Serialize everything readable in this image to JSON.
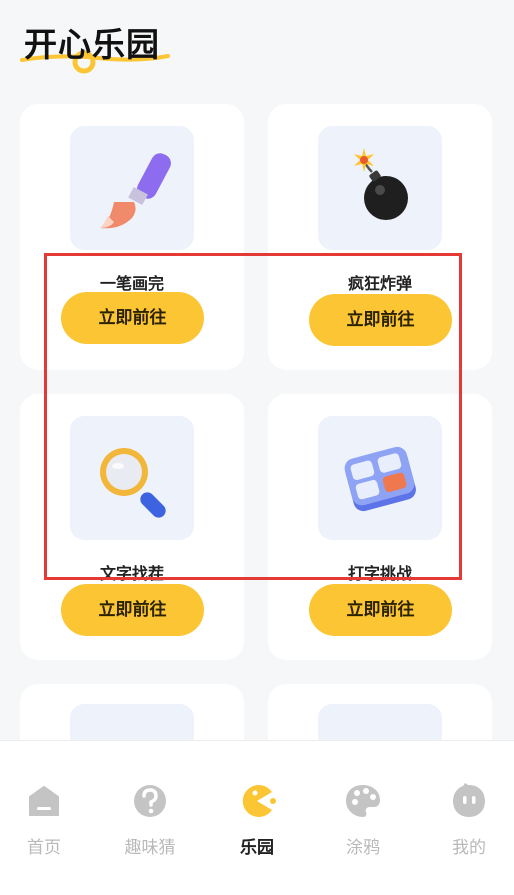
{
  "header": {
    "title": "开心乐园"
  },
  "colors": {
    "accent": "#fcc534",
    "highlight_border": "#e53935",
    "tab_inactive": "#c4c4c4",
    "tab_active": "#fcc534"
  },
  "cards": [
    {
      "label": "一笔画完",
      "button": "立即前往",
      "icon": "paintbrush-icon"
    },
    {
      "label": "疯狂炸弹",
      "button": "立即前往",
      "icon": "bomb-icon"
    },
    {
      "label": "文字找茬",
      "button": "立即前往",
      "icon": "magnifier-icon"
    },
    {
      "label": "打字挑战",
      "button": "立即前往",
      "icon": "keyboard-icon"
    }
  ],
  "tabbar": {
    "items": [
      {
        "label": "首页",
        "icon": "home-icon",
        "active": false
      },
      {
        "label": "趣味猜",
        "icon": "question-icon",
        "active": false
      },
      {
        "label": "乐园",
        "icon": "pacman-icon",
        "active": true
      },
      {
        "label": "涂鸦",
        "icon": "palette-icon",
        "active": false
      },
      {
        "label": "我的",
        "icon": "face-icon",
        "active": false
      }
    ]
  }
}
